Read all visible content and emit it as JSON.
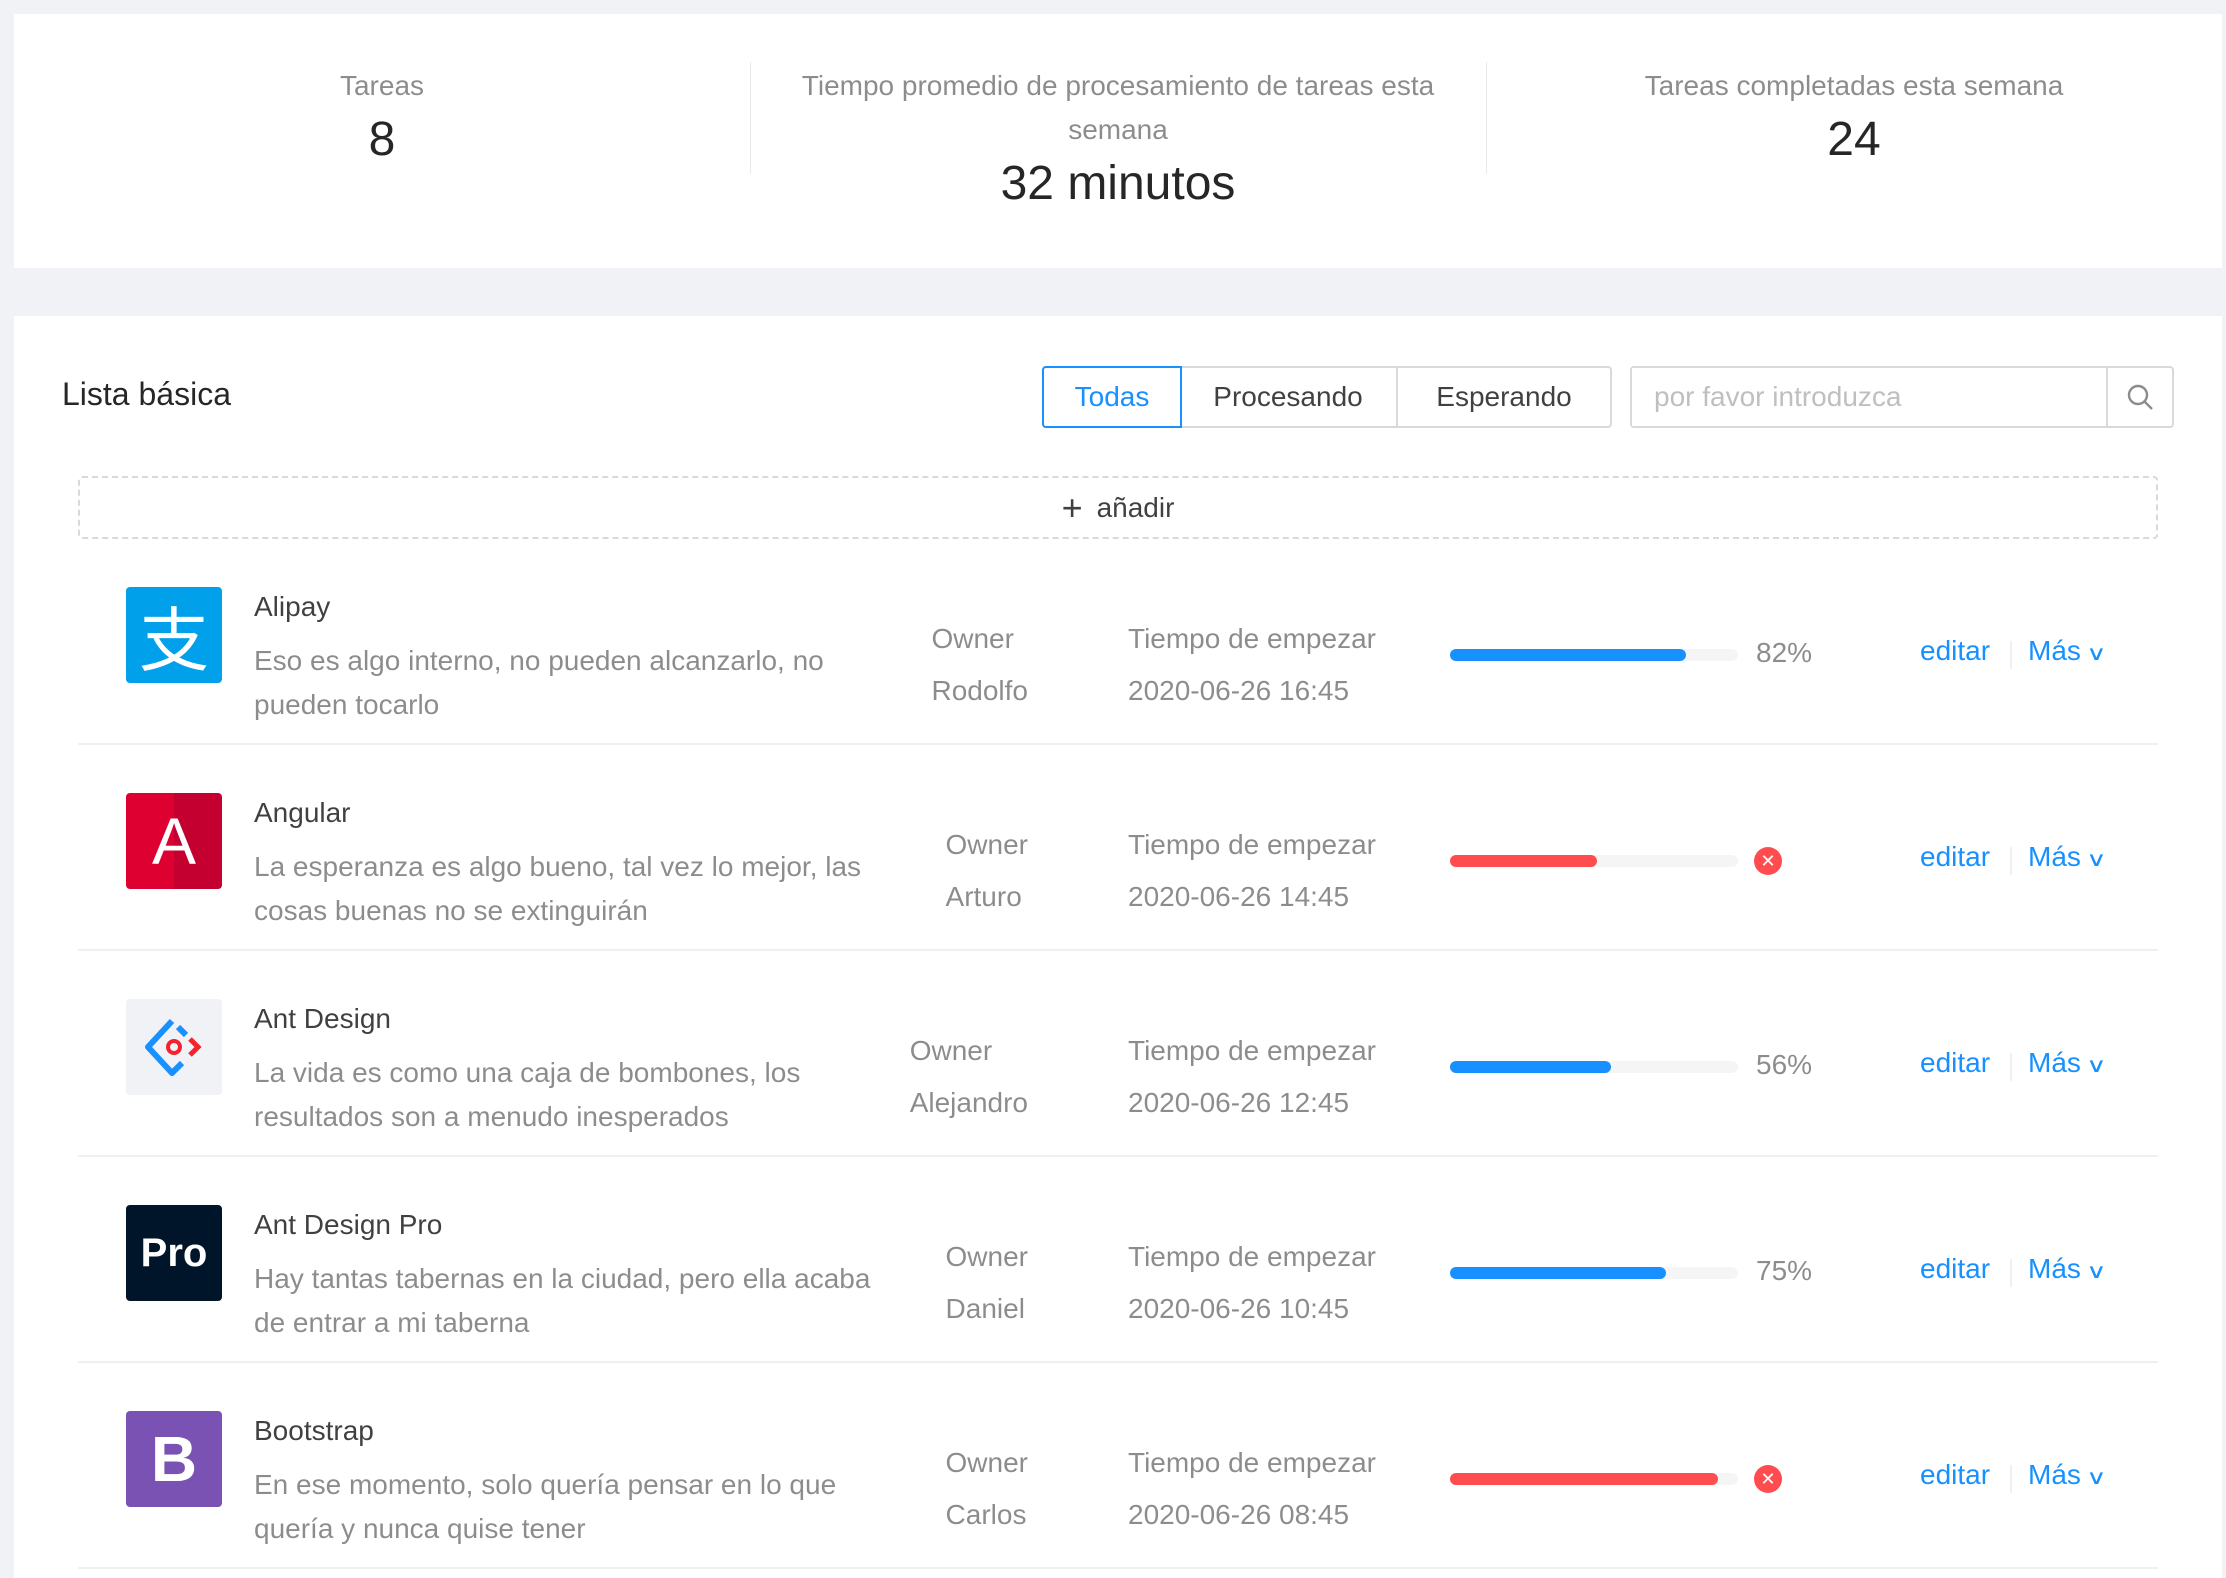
{
  "stats": [
    {
      "label": "Tareas",
      "value": "8"
    },
    {
      "label": "Tiempo promedio de procesamiento de tareas esta semana",
      "value": "32 minutos"
    },
    {
      "label": "Tareas completadas esta semana",
      "value": "24"
    }
  ],
  "list": {
    "title": "Lista básica",
    "filters": [
      "Todas",
      "Procesando",
      "Esperando"
    ],
    "active_filter": "Todas",
    "search_placeholder": "por favor introduzca",
    "add_label": "añadir",
    "owner_label": "Owner",
    "time_label": "Tiempo de empezar",
    "edit_label": "editar",
    "more_label": "Más",
    "items": [
      {
        "title": "Alipay",
        "desc": "Eso es algo interno, no pueden alcanzarlo, no pueden tocarlo",
        "owner": "Rodolfo",
        "time": "2020-06-26 16:45",
        "percent": 82,
        "status": "active",
        "percent_text": "82%",
        "logo": "支",
        "color": "#1890ff"
      },
      {
        "title": "Angular",
        "desc": "La esperanza es algo bueno, tal vez lo mejor, las cosas buenas no se extinguirán",
        "owner": "Arturo",
        "time": "2020-06-26 14:45",
        "percent": 51,
        "status": "exception",
        "percent_text": "",
        "logo": "A",
        "color": "#ff4d4f"
      },
      {
        "title": "Ant Design",
        "desc": "La vida es como una caja de bombones, los resultados son a menudo inesperados",
        "owner": "Alejandro",
        "time": "2020-06-26 12:45",
        "percent": 56,
        "status": "active",
        "percent_text": "56%",
        "logo": "",
        "color": "#1890ff"
      },
      {
        "title": "Ant Design Pro",
        "desc": "Hay tantas tabernas en la ciudad, pero ella acaba de entrar a mi taberna",
        "owner": "Daniel",
        "time": "2020-06-26 10:45",
        "percent": 75,
        "status": "active",
        "percent_text": "75%",
        "logo": "Pro",
        "color": "#1890ff"
      },
      {
        "title": "Bootstrap",
        "desc": "En ese momento, solo quería pensar en lo que quería y nunca quise tener",
        "owner": "Carlos",
        "time": "2020-06-26 08:45",
        "percent": 93,
        "status": "exception",
        "percent_text": "",
        "logo": "B",
        "color": "#ff4d4f"
      }
    ]
  }
}
